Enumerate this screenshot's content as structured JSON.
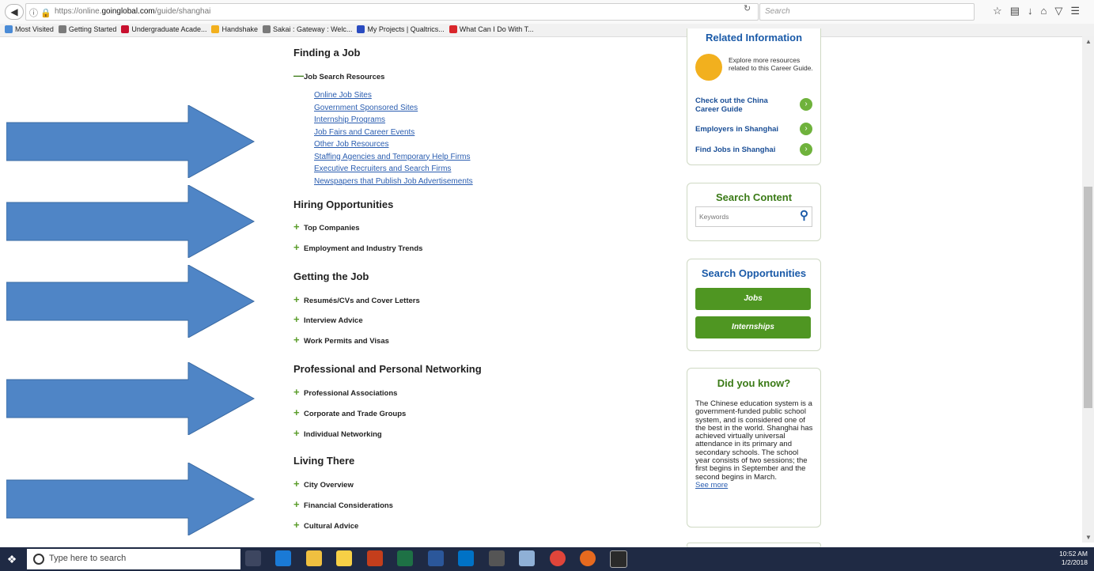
{
  "browser": {
    "back_icon": "back-arrow-icon",
    "url_prefix": "https://online.",
    "url_domain": "goinglobal.com",
    "url_path": "/guide/shanghai",
    "search_placeholder": "Search"
  },
  "bookmarks": [
    {
      "label": "Most Visited",
      "color": "#4a8bd6"
    },
    {
      "label": "Getting Started",
      "color": "#7a7a7a"
    },
    {
      "label": "Undergraduate Acade...",
      "color": "#c8102e"
    },
    {
      "label": "Handshake",
      "color": "#f2b01e"
    },
    {
      "label": "Sakai : Gateway : Welc...",
      "color": "#7a7a7a"
    },
    {
      "label": "My Projects | Qualtrics...",
      "color": "#2a4bc0"
    },
    {
      "label": "What Can I Do With T...",
      "color": "#d9262b"
    }
  ],
  "main": {
    "finding": {
      "heading": "Finding a Job",
      "subheading": "Job Search Resources",
      "links": [
        "Online Job Sites",
        "Government Sponsored Sites",
        "Internship Programs",
        "Job Fairs and Career Events",
        "Other Job Resources",
        "Staffing Agencies and Temporary Help Firms",
        "Executive Recruiters and Search Firms",
        "Newspapers that Publish Job Advertisements"
      ]
    },
    "hiring": {
      "heading": "Hiring Opportunities",
      "items": [
        "Top Companies",
        "Employment and Industry Trends"
      ]
    },
    "getting": {
      "heading": "Getting the Job",
      "items": [
        "Resumés/CVs and Cover Letters",
        "Interview Advice",
        "Work Permits and Visas"
      ]
    },
    "networking": {
      "heading": "Professional and Personal Networking",
      "items": [
        "Professional Associations",
        "Corporate and Trade Groups",
        "Individual Networking"
      ]
    },
    "living": {
      "heading": "Living There",
      "items": [
        "City Overview",
        "Financial Considerations",
        "Cultural Advice"
      ]
    }
  },
  "sidebar": {
    "related": {
      "title": "Related Information",
      "blurb": "Explore more resources related to this Career Guide.",
      "links": [
        "Check out the China Career Guide",
        "Employers in Shanghai",
        "Find Jobs in Shanghai"
      ]
    },
    "search_content": {
      "title": "Search Content",
      "placeholder": "Keywords"
    },
    "opportunities": {
      "title": "Search Opportunities",
      "jobs": "Jobs",
      "internships": "Internships"
    },
    "did_you_know": {
      "title": "Did you know?",
      "text": "The Chinese education system is a government-funded public school system, and is considered one of the best in the world. Shanghai has achieved virtually universal attendance in its primary and secondary schools. The school year consists of two sessions; the first begins in September and the second begins in March.",
      "more": "See more"
    }
  },
  "taskbar": {
    "search_placeholder": "Type here to search",
    "time": "10:52 AM",
    "date": "1/2/2018"
  }
}
